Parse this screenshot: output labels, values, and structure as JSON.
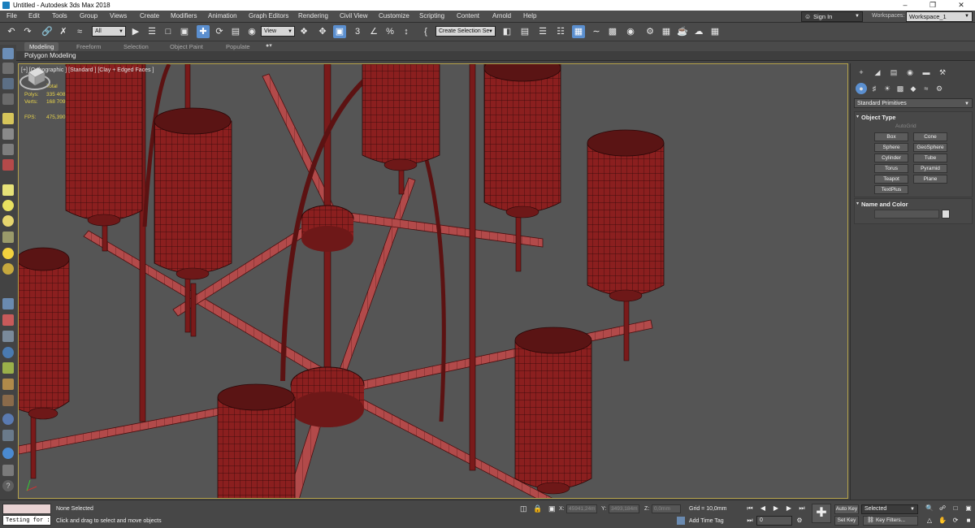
{
  "title_bar": {
    "title": "Untitled - Autodesk 3ds Max 2018",
    "minimize": "–",
    "maximize": "❐",
    "close": "✕"
  },
  "menu": [
    "File",
    "Edit",
    "Tools",
    "Group",
    "Views",
    "Create",
    "Modifiers",
    "Animation",
    "Graph Editors",
    "Rendering",
    "Civil View",
    "Customize",
    "Scripting",
    "Content",
    "Arnold",
    "Help"
  ],
  "sign_in": "Sign In",
  "workspaces_label": "Workspaces:",
  "workspace_value": "Workspace_1",
  "toolbar": {
    "filter": "All",
    "ref_coord": "View",
    "selection_set": "Create Selection Se"
  },
  "ribbon": {
    "tabs": [
      "Modeling",
      "Freeform",
      "Selection",
      "Object Paint",
      "Populate"
    ],
    "active": "Modeling",
    "sub": "Polygon Modeling"
  },
  "viewport": {
    "label": "[+] [Orthographic ] [Standard ] [Clay + Edged Faces ]",
    "stats": {
      "header": "Total",
      "polys_label": "Polys:",
      "polys": "335 408",
      "verts_label": "Verts:",
      "verts": "168 709",
      "fps_label": "FPS:",
      "fps": "475,390"
    },
    "mesh_color": "#8b1f1f"
  },
  "command_panel": {
    "category": "Standard Primitives",
    "object_type": {
      "header": "Object Type",
      "autogrid": "AutoGrid",
      "buttons": [
        "Box",
        "Cone",
        "Sphere",
        "GeoSphere",
        "Cylinder",
        "Tube",
        "Torus",
        "Pyramid",
        "Teapot",
        "Plane",
        "TextPlus"
      ]
    },
    "name_color": {
      "header": "Name and Color"
    }
  },
  "status": {
    "maxscript_input": "Testing for :",
    "selection": "None Selected",
    "prompt": "Click and drag to select and move objects",
    "x_label": "X:",
    "x": "45941,24m",
    "y_label": "Y:",
    "y": "3493,184m",
    "z_label": "Z:",
    "z": "0,0mm",
    "grid": "Grid = 10,0mm",
    "add_time_tag": "Add Time Tag",
    "frame": "0",
    "auto_key": "Auto Key",
    "set_key": "Set Key",
    "key_mode": "Selected",
    "key_filters": "Key Filters..."
  }
}
